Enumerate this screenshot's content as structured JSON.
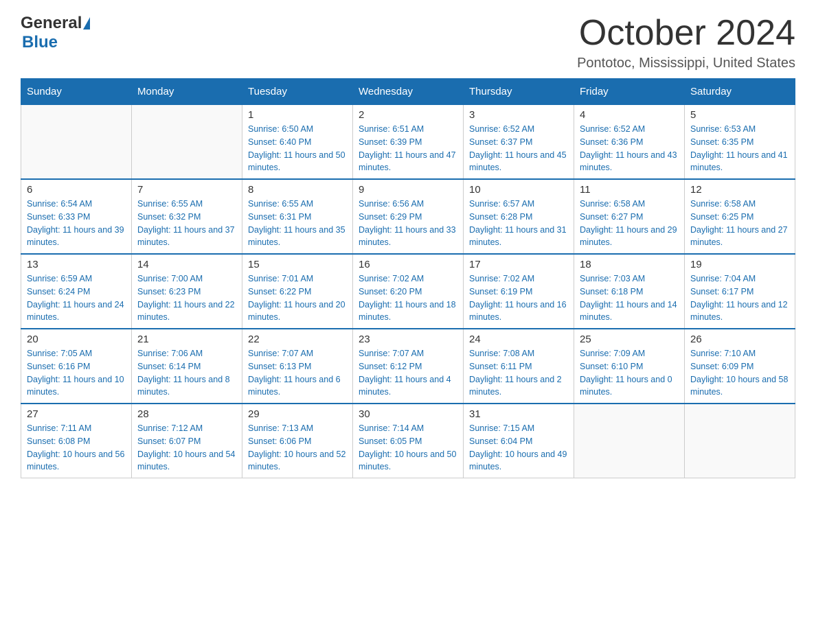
{
  "header": {
    "month": "October 2024",
    "location": "Pontotoc, Mississippi, United States",
    "logo_general": "General",
    "logo_blue": "Blue"
  },
  "weekdays": [
    "Sunday",
    "Monday",
    "Tuesday",
    "Wednesday",
    "Thursday",
    "Friday",
    "Saturday"
  ],
  "weeks": [
    [
      {
        "day": "",
        "sunrise": "",
        "sunset": "",
        "daylight": ""
      },
      {
        "day": "",
        "sunrise": "",
        "sunset": "",
        "daylight": ""
      },
      {
        "day": "1",
        "sunrise": "Sunrise: 6:50 AM",
        "sunset": "Sunset: 6:40 PM",
        "daylight": "Daylight: 11 hours and 50 minutes."
      },
      {
        "day": "2",
        "sunrise": "Sunrise: 6:51 AM",
        "sunset": "Sunset: 6:39 PM",
        "daylight": "Daylight: 11 hours and 47 minutes."
      },
      {
        "day": "3",
        "sunrise": "Sunrise: 6:52 AM",
        "sunset": "Sunset: 6:37 PM",
        "daylight": "Daylight: 11 hours and 45 minutes."
      },
      {
        "day": "4",
        "sunrise": "Sunrise: 6:52 AM",
        "sunset": "Sunset: 6:36 PM",
        "daylight": "Daylight: 11 hours and 43 minutes."
      },
      {
        "day": "5",
        "sunrise": "Sunrise: 6:53 AM",
        "sunset": "Sunset: 6:35 PM",
        "daylight": "Daylight: 11 hours and 41 minutes."
      }
    ],
    [
      {
        "day": "6",
        "sunrise": "Sunrise: 6:54 AM",
        "sunset": "Sunset: 6:33 PM",
        "daylight": "Daylight: 11 hours and 39 minutes."
      },
      {
        "day": "7",
        "sunrise": "Sunrise: 6:55 AM",
        "sunset": "Sunset: 6:32 PM",
        "daylight": "Daylight: 11 hours and 37 minutes."
      },
      {
        "day": "8",
        "sunrise": "Sunrise: 6:55 AM",
        "sunset": "Sunset: 6:31 PM",
        "daylight": "Daylight: 11 hours and 35 minutes."
      },
      {
        "day": "9",
        "sunrise": "Sunrise: 6:56 AM",
        "sunset": "Sunset: 6:29 PM",
        "daylight": "Daylight: 11 hours and 33 minutes."
      },
      {
        "day": "10",
        "sunrise": "Sunrise: 6:57 AM",
        "sunset": "Sunset: 6:28 PM",
        "daylight": "Daylight: 11 hours and 31 minutes."
      },
      {
        "day": "11",
        "sunrise": "Sunrise: 6:58 AM",
        "sunset": "Sunset: 6:27 PM",
        "daylight": "Daylight: 11 hours and 29 minutes."
      },
      {
        "day": "12",
        "sunrise": "Sunrise: 6:58 AM",
        "sunset": "Sunset: 6:25 PM",
        "daylight": "Daylight: 11 hours and 27 minutes."
      }
    ],
    [
      {
        "day": "13",
        "sunrise": "Sunrise: 6:59 AM",
        "sunset": "Sunset: 6:24 PM",
        "daylight": "Daylight: 11 hours and 24 minutes."
      },
      {
        "day": "14",
        "sunrise": "Sunrise: 7:00 AM",
        "sunset": "Sunset: 6:23 PM",
        "daylight": "Daylight: 11 hours and 22 minutes."
      },
      {
        "day": "15",
        "sunrise": "Sunrise: 7:01 AM",
        "sunset": "Sunset: 6:22 PM",
        "daylight": "Daylight: 11 hours and 20 minutes."
      },
      {
        "day": "16",
        "sunrise": "Sunrise: 7:02 AM",
        "sunset": "Sunset: 6:20 PM",
        "daylight": "Daylight: 11 hours and 18 minutes."
      },
      {
        "day": "17",
        "sunrise": "Sunrise: 7:02 AM",
        "sunset": "Sunset: 6:19 PM",
        "daylight": "Daylight: 11 hours and 16 minutes."
      },
      {
        "day": "18",
        "sunrise": "Sunrise: 7:03 AM",
        "sunset": "Sunset: 6:18 PM",
        "daylight": "Daylight: 11 hours and 14 minutes."
      },
      {
        "day": "19",
        "sunrise": "Sunrise: 7:04 AM",
        "sunset": "Sunset: 6:17 PM",
        "daylight": "Daylight: 11 hours and 12 minutes."
      }
    ],
    [
      {
        "day": "20",
        "sunrise": "Sunrise: 7:05 AM",
        "sunset": "Sunset: 6:16 PM",
        "daylight": "Daylight: 11 hours and 10 minutes."
      },
      {
        "day": "21",
        "sunrise": "Sunrise: 7:06 AM",
        "sunset": "Sunset: 6:14 PM",
        "daylight": "Daylight: 11 hours and 8 minutes."
      },
      {
        "day": "22",
        "sunrise": "Sunrise: 7:07 AM",
        "sunset": "Sunset: 6:13 PM",
        "daylight": "Daylight: 11 hours and 6 minutes."
      },
      {
        "day": "23",
        "sunrise": "Sunrise: 7:07 AM",
        "sunset": "Sunset: 6:12 PM",
        "daylight": "Daylight: 11 hours and 4 minutes."
      },
      {
        "day": "24",
        "sunrise": "Sunrise: 7:08 AM",
        "sunset": "Sunset: 6:11 PM",
        "daylight": "Daylight: 11 hours and 2 minutes."
      },
      {
        "day": "25",
        "sunrise": "Sunrise: 7:09 AM",
        "sunset": "Sunset: 6:10 PM",
        "daylight": "Daylight: 11 hours and 0 minutes."
      },
      {
        "day": "26",
        "sunrise": "Sunrise: 7:10 AM",
        "sunset": "Sunset: 6:09 PM",
        "daylight": "Daylight: 10 hours and 58 minutes."
      }
    ],
    [
      {
        "day": "27",
        "sunrise": "Sunrise: 7:11 AM",
        "sunset": "Sunset: 6:08 PM",
        "daylight": "Daylight: 10 hours and 56 minutes."
      },
      {
        "day": "28",
        "sunrise": "Sunrise: 7:12 AM",
        "sunset": "Sunset: 6:07 PM",
        "daylight": "Daylight: 10 hours and 54 minutes."
      },
      {
        "day": "29",
        "sunrise": "Sunrise: 7:13 AM",
        "sunset": "Sunset: 6:06 PM",
        "daylight": "Daylight: 10 hours and 52 minutes."
      },
      {
        "day": "30",
        "sunrise": "Sunrise: 7:14 AM",
        "sunset": "Sunset: 6:05 PM",
        "daylight": "Daylight: 10 hours and 50 minutes."
      },
      {
        "day": "31",
        "sunrise": "Sunrise: 7:15 AM",
        "sunset": "Sunset: 6:04 PM",
        "daylight": "Daylight: 10 hours and 49 minutes."
      },
      {
        "day": "",
        "sunrise": "",
        "sunset": "",
        "daylight": ""
      },
      {
        "day": "",
        "sunrise": "",
        "sunset": "",
        "daylight": ""
      }
    ]
  ]
}
